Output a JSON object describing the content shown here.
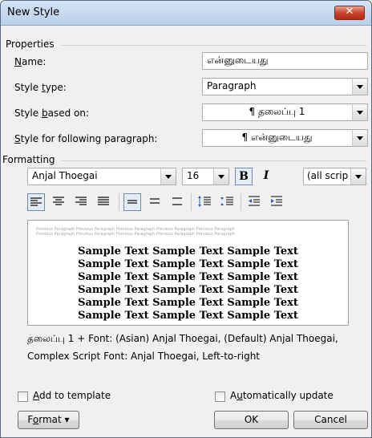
{
  "window": {
    "title": "New Style",
    "close_glyph": "✕"
  },
  "properties": {
    "group_label": "Properties",
    "name_label_key": "N",
    "name_label_rest": "ame:",
    "name_value": "என்னுடையது",
    "style_type_pre": "Style ",
    "style_type_key": "t",
    "style_type_post": "ype:",
    "style_type_value": "Paragraph",
    "based_pre": "Style ",
    "based_key": "b",
    "based_post": "ased on:",
    "based_value": "¶ தலைப்பு 1",
    "following_key": "S",
    "following_post": "tyle for following paragraph:",
    "following_value": "¶ என்னுடையது"
  },
  "formatting": {
    "group_label": "Formatting",
    "font_name": "Anjal Thoegai",
    "font_size": "16",
    "bold_label": "B",
    "italic_label": "I",
    "script_value": "(all scrip",
    "toolbar_icons": [
      "align-left-icon",
      "align-center-icon",
      "align-right-icon",
      "justify-icon",
      "single-spacing-icon",
      "one-half-spacing-icon",
      "double-spacing-icon",
      "increase-paragraph-spacing-icon",
      "decrease-paragraph-spacing-icon",
      "decrease-indent-icon",
      "increase-indent-icon"
    ]
  },
  "preview": {
    "previous_line_1": "Previous Paragraph Previous Paragraph Previous Paragraph Previous Paragraph Previous Paragraph",
    "previous_line_2": "Previous Paragraph Previous Paragraph Previous Paragraph Previous Paragraph Previous Paragraph",
    "sample_line": "Sample Text Sample Text Sample Text"
  },
  "description": {
    "line1": "தலைப்பு 1 + Font: (Asian) Anjal Thoegai, (Default) Anjal Thoegai,",
    "line2": "Complex Script Font: Anjal Thoegai, Left-to-right"
  },
  "options": {
    "add_template_key": "A",
    "add_template_post": "dd to template",
    "auto_update_pre": "A",
    "auto_update_key": "u",
    "auto_update_post": "tomatically update"
  },
  "buttons": {
    "format_pre": "F",
    "format_key": "o",
    "format_post": "rmat ▾",
    "ok": "OK",
    "cancel": "Cancel"
  }
}
